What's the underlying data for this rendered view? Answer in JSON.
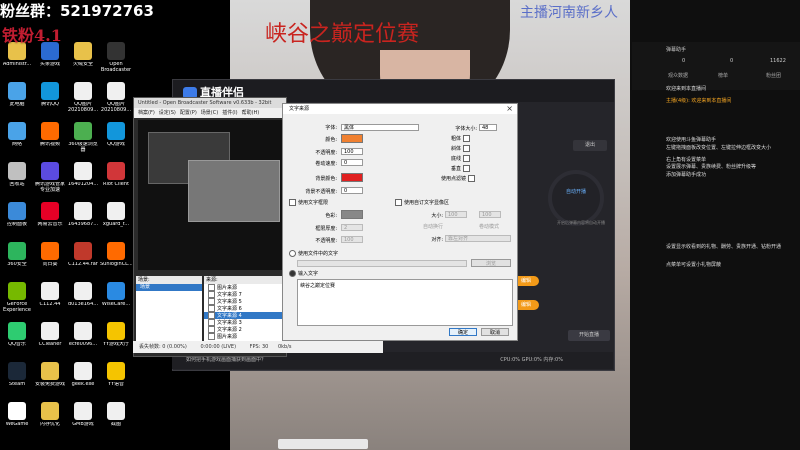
{
  "overlay": {
    "fan_label": "粉丝群：521972763",
    "sub_text": "铁粉4.1",
    "title": "峡谷之巅定位赛",
    "location": "主播河南新乡人"
  },
  "desktop_icons": [
    {
      "label": "Administr...",
      "icon": "folder-icon",
      "color": "#e8c14a"
    },
    {
      "label": "此电脑",
      "icon": "computer-icon",
      "color": "#4aa3e8"
    },
    {
      "label": "网络",
      "icon": "network-icon",
      "color": "#4aa3e8"
    },
    {
      "label": "回收站",
      "icon": "recycle-bin-icon",
      "color": "#c0c0c0"
    },
    {
      "label": "控制面板",
      "icon": "control-panel-icon",
      "color": "#3b8ad9"
    },
    {
      "label": "360安全",
      "icon": "shield-icon",
      "color": "#2db55d"
    },
    {
      "label": "GeForce Experience",
      "icon": "geforce-icon",
      "color": "#76b900"
    },
    {
      "label": "QQ音乐",
      "icon": "qq-music-icon",
      "color": "#2ecc71"
    },
    {
      "label": "Steam",
      "icon": "steam-icon",
      "color": "#1b2838"
    },
    {
      "label": "WeGame",
      "icon": "wegame-icon",
      "color": "#ffffff"
    },
    {
      "label": "头条游戏",
      "icon": "game-icon",
      "color": "#2b6bd1"
    },
    {
      "label": "腾讯QQ",
      "icon": "qq-icon",
      "color": "#1296db"
    },
    {
      "label": "腾讯视频",
      "icon": "video-icon",
      "color": "#ff6a00"
    },
    {
      "label": "腾讯游戏管家专业加速",
      "icon": "accel-icon",
      "color": "#5b4be0"
    },
    {
      "label": "网易云音乐",
      "icon": "music-icon",
      "color": "#e60026"
    },
    {
      "label": "向日葵",
      "icon": "sunflower-icon",
      "color": "#ff6a00"
    },
    {
      "label": "C112.44",
      "icon": "file-icon",
      "color": "#f0f0f0"
    },
    {
      "label": "CCleaner",
      "icon": "ccleaner-icon",
      "color": "#f0f0f0"
    },
    {
      "label": "安装免费游戏",
      "icon": "folder-icon",
      "color": "#e8c14a"
    },
    {
      "label": "内存优化",
      "icon": "memory-icon",
      "color": "#e8c14a"
    },
    {
      "label": "火绒安全",
      "icon": "huorong-icon",
      "color": "#e8c14a"
    },
    {
      "label": "QQ图片20210809...",
      "icon": "image-icon",
      "color": "#f0f0f0"
    },
    {
      "label": "360极速浏览器",
      "icon": "browser-icon",
      "color": "#4caf50"
    },
    {
      "label": "16401204...",
      "icon": "image-icon",
      "color": "#f0f0f0"
    },
    {
      "label": "16439687...",
      "icon": "image-icon",
      "color": "#f0f0f0"
    },
    {
      "label": "C112.44.rar",
      "icon": "archive-icon",
      "color": "#c0392b"
    },
    {
      "label": "d013e164...",
      "icon": "image-icon",
      "color": "#f0f0f0"
    },
    {
      "label": "ecfe0096...",
      "icon": "image-icon",
      "color": "#f0f0f0"
    },
    {
      "label": "geek.exe",
      "icon": "exe-icon",
      "color": "#f0f0f0"
    },
    {
      "label": "GMB游戏",
      "icon": "game-icon",
      "color": "#f0f0f0"
    },
    {
      "label": "Open Broadcaster",
      "icon": "obs-icon",
      "color": "#333333"
    },
    {
      "label": "QQ图片20210809...",
      "icon": "image-icon",
      "color": "#f0f0f0"
    },
    {
      "label": "QQ游戏",
      "icon": "qq-game-icon",
      "color": "#1296db"
    },
    {
      "label": "Riot Client",
      "icon": "riot-icon",
      "color": "#d13639"
    },
    {
      "label": "xguard_f...",
      "icon": "file-icon",
      "color": "#f0f0f0"
    },
    {
      "label": "SunloginCL...",
      "icon": "sunlogin-icon",
      "color": "#ff6a00"
    },
    {
      "label": "WiseCare...",
      "icon": "wisecare-icon",
      "color": "#2a8ae2"
    },
    {
      "label": "YY游戏大厅",
      "icon": "yy-icon",
      "color": "#f5c400"
    },
    {
      "label": "YY语音",
      "icon": "yy-icon",
      "color": "#f5c400"
    },
    {
      "label": "截图",
      "icon": "image-icon",
      "color": "#f0f0f0"
    }
  ],
  "obs": {
    "title": "Untitled - Open Broadcaster Software v0.633b - 32bit",
    "menu": [
      "档案(F)",
      "设定(S)",
      "配置(P)",
      "场景(C)",
      "插件(I)",
      "帮助(H)"
    ],
    "scenes_label": "场景:",
    "scene_items": [
      "场景"
    ],
    "sources_label": "来源:",
    "source_items": [
      "图片来源",
      "文字来源 7",
      "文字来源 5",
      "文字来源 6",
      "文字来源 4",
      "文字来源 3",
      "文字来源 2",
      "图片来源"
    ],
    "selected_source_index": 4,
    "status_fps": "FPS: 30",
    "status_kbps": "0kb/s",
    "status_dropped": "丢失帧数: 0 (0.00%)",
    "status_time": "0:00:00 (LIVE)",
    "status_local": "本地录制: 0:00"
  },
  "zhibo": {
    "logo": "直播伴侣",
    "pause_label": "退出",
    "stop_label": "开始直播",
    "circle_label": "自动开播",
    "circle_sub": "开启后弹幕内容将自动开播",
    "orange_1": "编辑",
    "orange_2": "编辑",
    "status_text": "如何把手机游戏画面捕获到画面中？",
    "status_right": "CPU:0%  GPU:0%  内存:0%"
  },
  "dialog": {
    "title": "文字来源",
    "font_label": "字体:",
    "font_value": "黑体",
    "color_label": "颜色:",
    "color_hex": "#f08030",
    "opacity_label": "不透明度:",
    "opacity_value": "100",
    "scroll_label": "卷动速度:",
    "scroll_value": "0",
    "bg_color_label": "背景颜色:",
    "bg_color_hex": "#e02020",
    "bg_opacity_label": "背景不透明度:",
    "bg_opacity_value": "0",
    "font_size_label": "字体大小:",
    "font_size_value": "48",
    "bold_label": "粗体",
    "italic_label": "斜体",
    "underline_label": "底线",
    "vertical_label": "垂直",
    "pointfilter_label": "使用点滤镜",
    "outline_label": "使用文字框限",
    "outline_color_label": "色彩:",
    "outline_color_hex": "#888888",
    "outline_thick_label": "框限厚度:",
    "outline_thick_value": "2",
    "outline_opacity_label": "不透明度:",
    "outline_opacity_value": "100",
    "custom_area_label": "使用自订文字显像区",
    "size_label": "大小:",
    "size_w": "100",
    "size_h": "100",
    "wrap_label": "自动换行",
    "scroll_mode_label": "卷动模式",
    "align_label": "对齐:",
    "align_value": "靠左对齐",
    "use_file_label": "使用文件中的文字",
    "browse_label": "浏览",
    "input_label": "输入文字",
    "input_text": "峡谷之巅定位赛",
    "ok_label": "确定",
    "cancel_label": "取消"
  },
  "chat": {
    "header_name": "弹幕助手",
    "count_a": "0",
    "count_b": "0",
    "count_c": "11622",
    "tab_1": "观众数据",
    "tab_2": "榜单",
    "tab_3": "粉丝团",
    "lines": [
      {
        "text": "欢迎来到本直播间",
        "orange": false
      },
      {
        "text": "主播(4级): 欢迎来到本直播间",
        "orange": true
      },
      {
        "text": "欢迎使用斗鱼弹幕助手",
        "orange": false
      },
      {
        "text": "左键拖拽面板改变位置、左键拉伸边框改变大小",
        "orange": false
      },
      {
        "text": "右上角有设置菜单",
        "orange": false
      },
      {
        "text": "设置展示弹幕、贵族续费、粉丝牌升级等",
        "orange": false
      },
      {
        "text": "添加弹幕助手成功",
        "orange": false
      },
      {
        "text": "设置显示收看到的礼物、酬劳、贵族开通、钻粉开通",
        "orange": false
      },
      {
        "text": "点菜单可设置小礼物屏蔽",
        "orange": false
      }
    ]
  }
}
